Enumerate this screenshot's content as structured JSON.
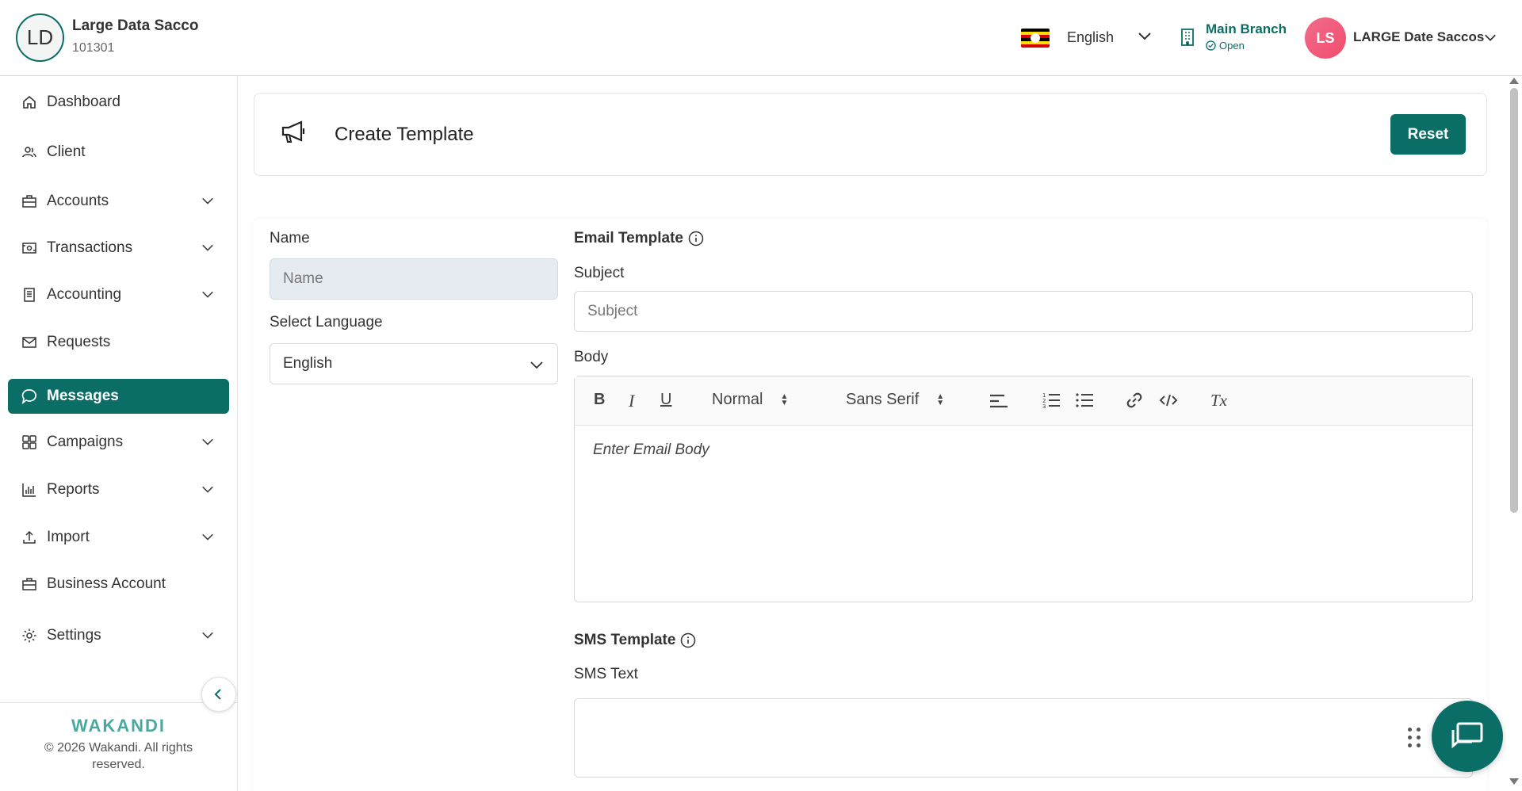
{
  "header": {
    "org_initials": "LD",
    "org_name": "Large Data Sacco",
    "org_code": "101301",
    "language": "English",
    "branch_name": "Main Branch",
    "branch_status": "Open",
    "user_initials": "LS",
    "user_name": "LARGE Date Saccos"
  },
  "sidebar": {
    "items": [
      {
        "label": "Dashboard",
        "icon": "home-icon"
      },
      {
        "label": "Client",
        "icon": "users-icon"
      },
      {
        "label": "Accounts",
        "icon": "briefcase-icon"
      },
      {
        "label": "Transactions",
        "icon": "cash-icon"
      },
      {
        "label": "Accounting",
        "icon": "ledger-icon"
      },
      {
        "label": "Requests",
        "icon": "mail-icon"
      },
      {
        "label": "Messages",
        "icon": "chat-icon"
      },
      {
        "label": "Campaigns",
        "icon": "grid-icon"
      },
      {
        "label": "Reports",
        "icon": "bar-chart-icon"
      },
      {
        "label": "Import",
        "icon": "upload-icon"
      },
      {
        "label": "Business Account",
        "icon": "briefcase-icon"
      },
      {
        "label": "Settings",
        "icon": "gear-icon"
      }
    ],
    "active": "Messages",
    "brand": "WAKANDI",
    "copyright": "© 2026 Wakandi. All rights reserved."
  },
  "page": {
    "title": "Create Template",
    "reset_label": "Reset"
  },
  "form": {
    "name_label": "Name",
    "name_placeholder": "Name",
    "language_label": "Select Language",
    "language_value": "English",
    "email_section": "Email Template",
    "subject_label": "Subject",
    "subject_placeholder": "Subject",
    "body_label": "Body",
    "body_placeholder": "Enter Email Body",
    "toolbar": {
      "bold": "B",
      "italic": "I",
      "underline": "U",
      "size": "Normal",
      "font": "Sans Serif",
      "clear": "Tx"
    },
    "sms_section": "SMS Template",
    "sms_label": "SMS Text"
  },
  "colors": {
    "accent": "#0b6e66",
    "avatar": "#f04e6e"
  }
}
